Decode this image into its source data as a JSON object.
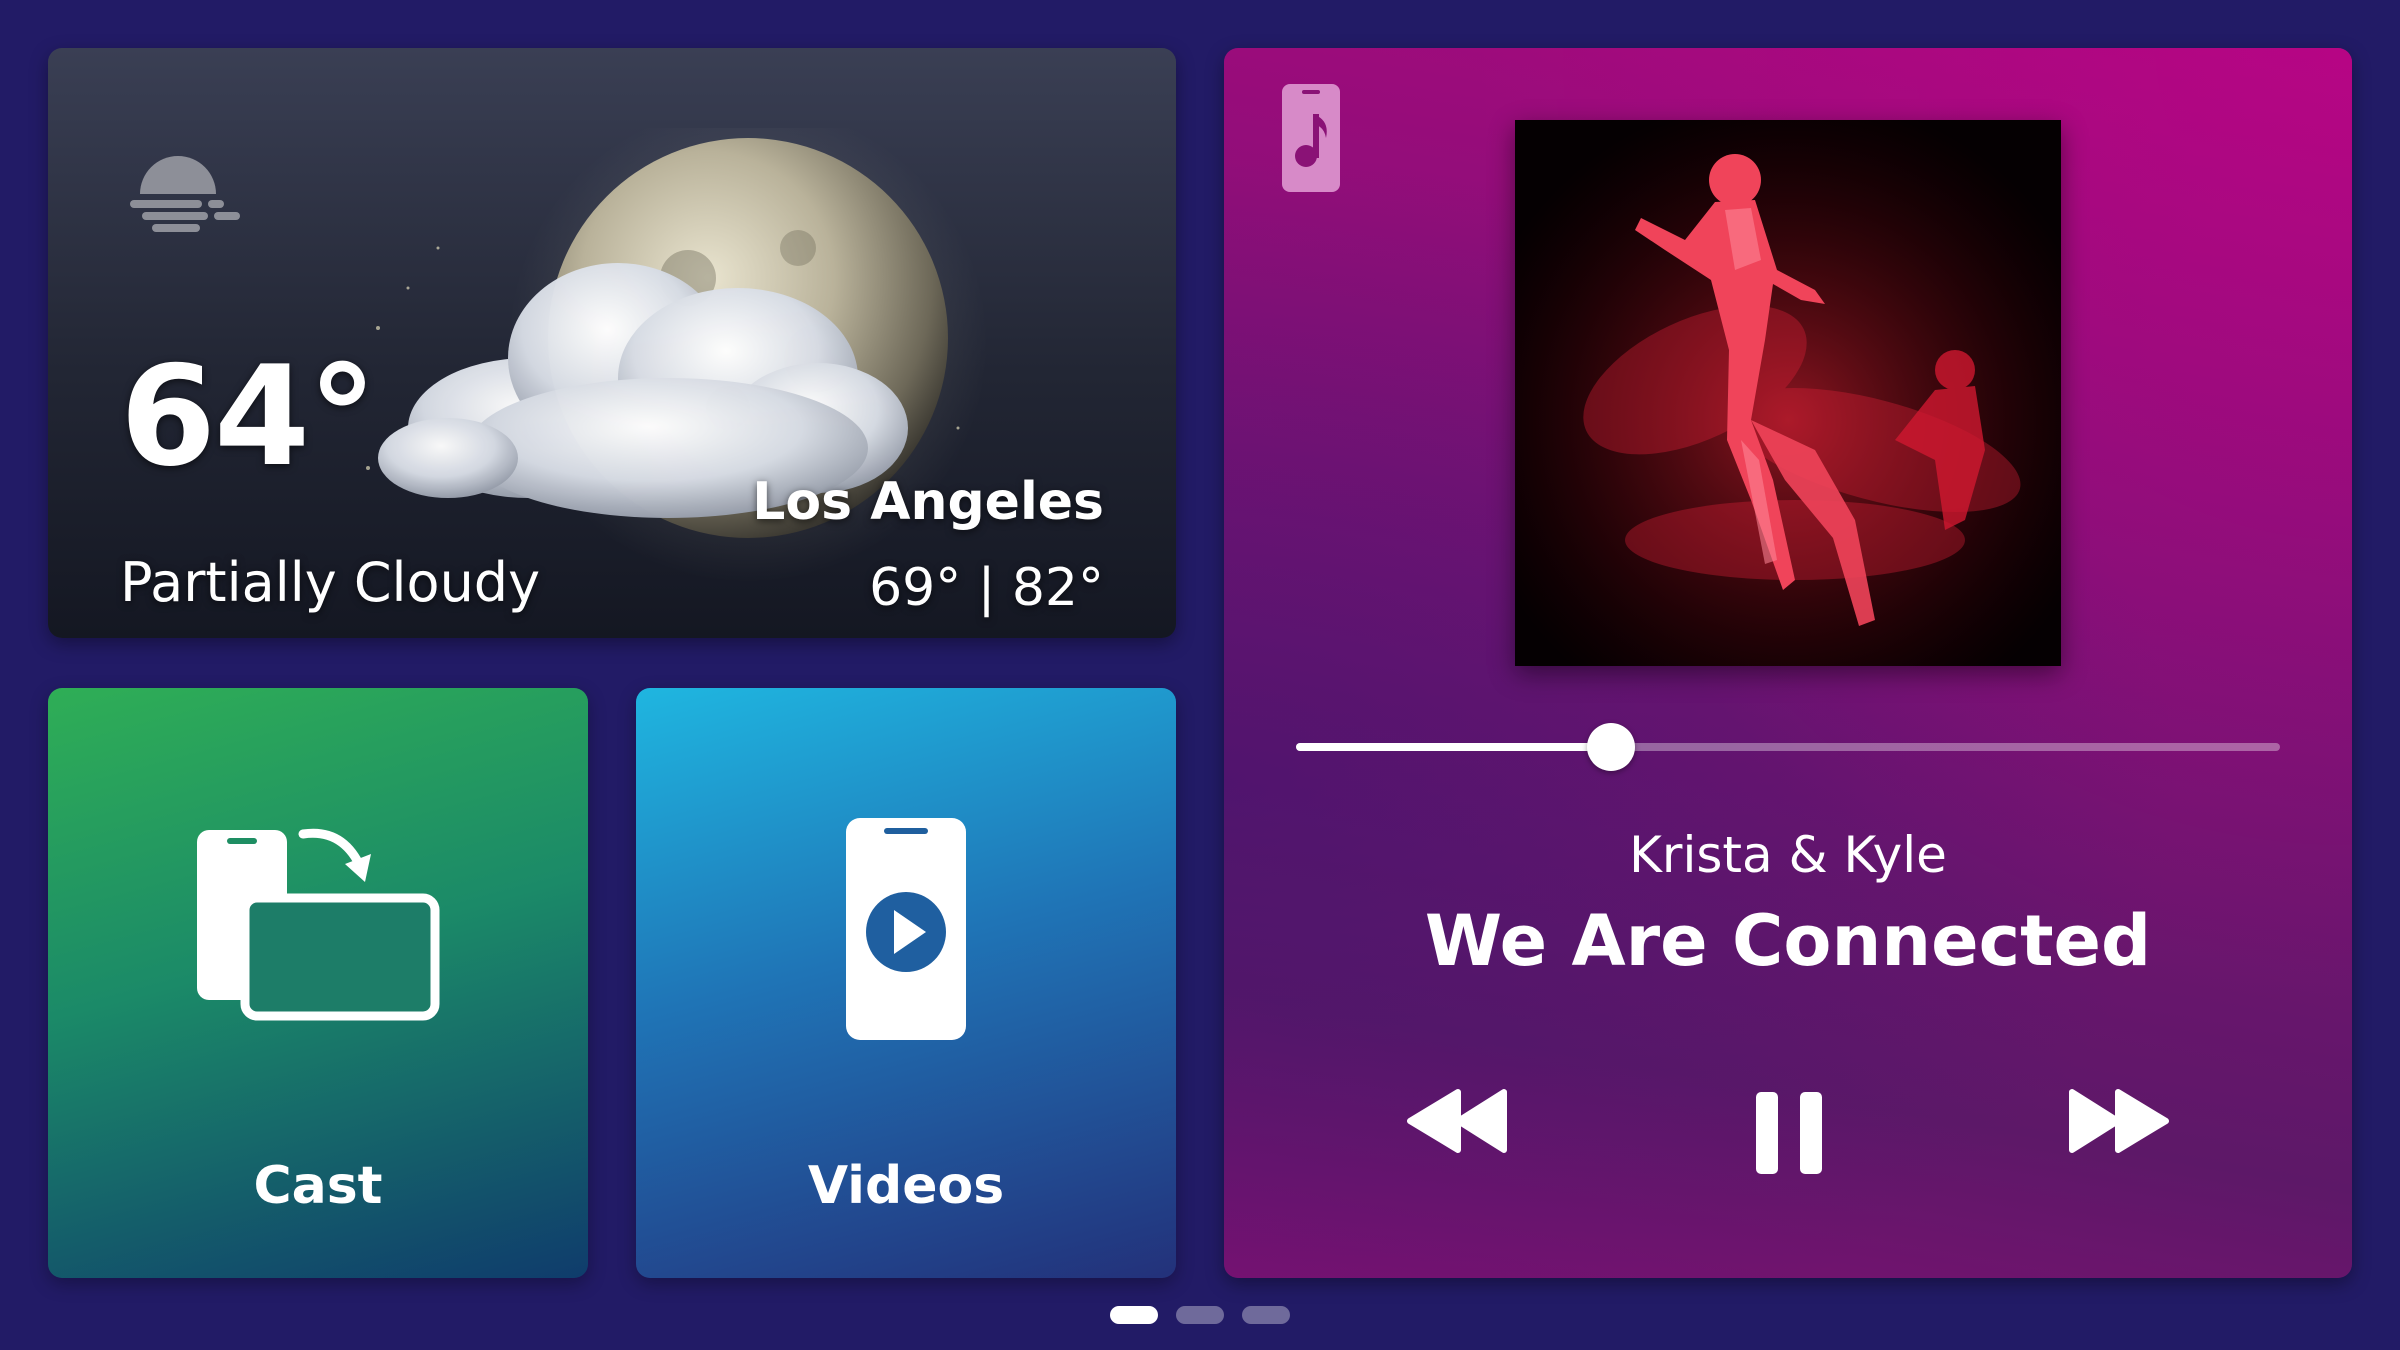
{
  "weather": {
    "icon": "moon-fog-icon",
    "temperature": "64°",
    "condition": "Partially Cloudy",
    "city": "Los Angeles",
    "hi_lo": "69° | 82°"
  },
  "tiles": {
    "cast": {
      "label": "Cast",
      "icon": "cast-icon"
    },
    "videos": {
      "label": "Videos",
      "icon": "phone-play-icon"
    }
  },
  "music": {
    "source_icon": "phone-music-icon",
    "artist": "Krista & Kyle",
    "title": "We Are Connected",
    "progress": 0.32,
    "controls": [
      "rewind-icon",
      "pause-icon",
      "fast-forward-icon"
    ]
  },
  "pager": {
    "pages": 3,
    "active": 0
  },
  "colors": {
    "background": "#221b66",
    "cast_tile": "#2fae56",
    "videos_tile": "#1fb6e0",
    "music_card": "#a8097e"
  }
}
